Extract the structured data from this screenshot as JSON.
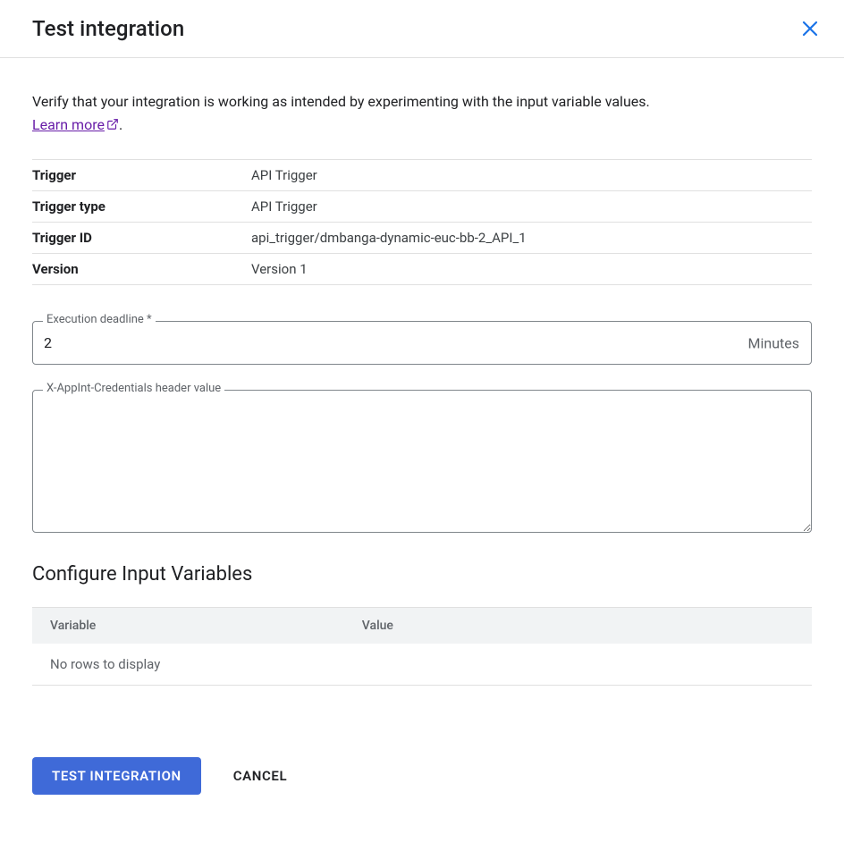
{
  "header": {
    "title": "Test integration"
  },
  "description_text": "Verify that your integration is working as intended by experimenting with the input variable values. ",
  "learn_more_label": "Learn more",
  "details": {
    "rows": [
      {
        "label": "Trigger",
        "value": "API Trigger"
      },
      {
        "label": "Trigger type",
        "value": "API Trigger"
      },
      {
        "label": "Trigger ID",
        "value": "api_trigger/dmbanga-dynamic-euc-bb-2_API_1"
      },
      {
        "label": "Version",
        "value": "Version 1"
      }
    ]
  },
  "execution_deadline": {
    "label": "Execution deadline *",
    "value": "2",
    "suffix": "Minutes"
  },
  "credentials": {
    "label": "X-AppInt-Credentials header value",
    "value": ""
  },
  "input_vars": {
    "title": "Configure Input Variables",
    "col_variable": "Variable",
    "col_value": "Value",
    "empty": "No rows to display"
  },
  "actions": {
    "test": "Test integration",
    "cancel": "Cancel"
  }
}
